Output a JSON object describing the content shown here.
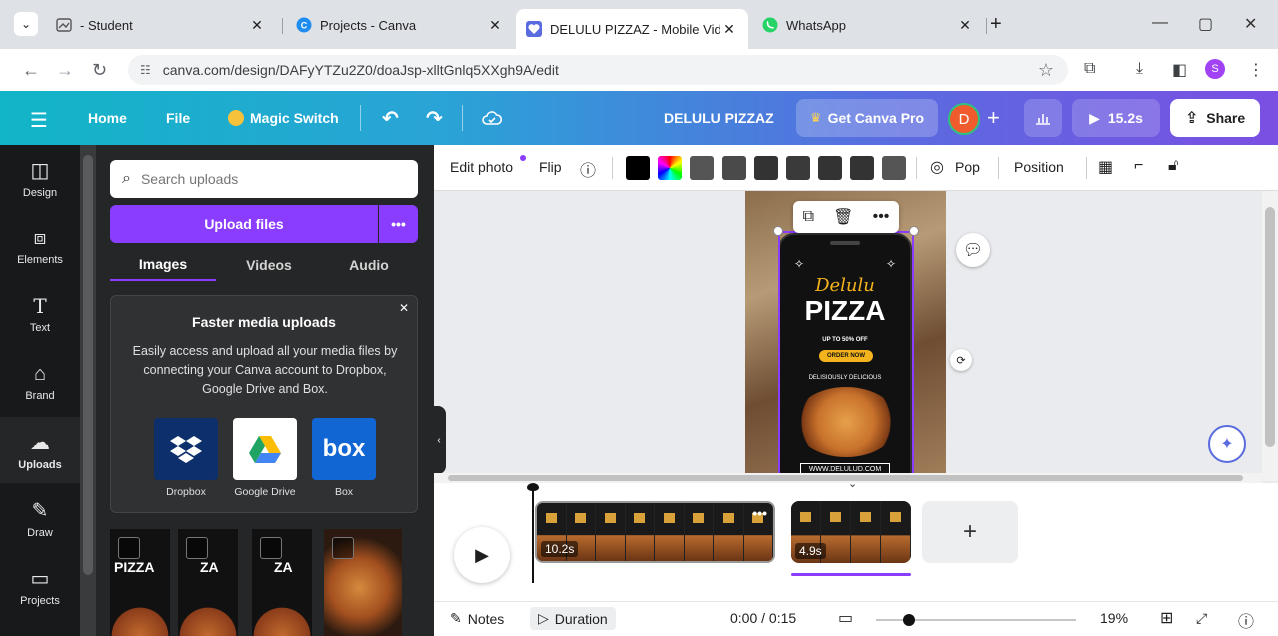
{
  "browser": {
    "tabs": [
      {
        "title": "- Student",
        "active": false
      },
      {
        "title": "Projects - Canva",
        "active": false
      },
      {
        "title": "DELULU PIZZAZ - Mobile Video",
        "active": true
      },
      {
        "title": "WhatsApp",
        "active": false
      }
    ],
    "url": "canva.com/design/DAFyYTZu2Z0/doaJsp-xlltGnlq5XXgh9A/edit",
    "profile_initial": "S"
  },
  "canva_bar": {
    "home": "Home",
    "file": "File",
    "magic_switch": "Magic Switch",
    "design_title": "DELULU PIZZAZ",
    "get_pro": "Get Canva Pro",
    "avatar_initial": "D",
    "duration": "15.2s",
    "share": "Share"
  },
  "rail": {
    "items": [
      {
        "label": "Design",
        "icon": "design-icon"
      },
      {
        "label": "Elements",
        "icon": "elements-icon"
      },
      {
        "label": "Text",
        "icon": "text-icon"
      },
      {
        "label": "Brand",
        "icon": "brand-icon"
      },
      {
        "label": "Uploads",
        "icon": "uploads-icon",
        "active": true
      },
      {
        "label": "Draw",
        "icon": "draw-icon"
      },
      {
        "label": "Projects",
        "icon": "projects-icon"
      }
    ]
  },
  "panel": {
    "search_placeholder": "Search uploads",
    "upload_label": "Upload files",
    "more_label": "•••",
    "tabs": [
      "Images",
      "Videos",
      "Audio"
    ],
    "card": {
      "title": "Faster media uploads",
      "body": "Easily access and upload all your media files by connecting your Canva account to Dropbox, Google Drive and Box.",
      "services": [
        "Dropbox",
        "Google Drive",
        "Box"
      ],
      "box_logo": "box"
    },
    "thumb_text": [
      "PIZZA",
      "ZA",
      "ZA"
    ]
  },
  "context_bar": {
    "edit_photo": "Edit photo",
    "flip": "Flip",
    "pop": "Pop",
    "position": "Position",
    "swatches": [
      "#000000",
      "rainbow",
      "#555555",
      "#4a4a4a",
      "#333333",
      "#3a3a3a",
      "#333333",
      "#333333",
      "#555555"
    ]
  },
  "design": {
    "script_title": "Delulu",
    "main_title": "PIZZA",
    "offer": "UP TO 50% OFF",
    "cta": "ORDER NOW",
    "tagline": "DELISIOUSLY DELICIOUS",
    "website": "WWW.DELULUD.COM"
  },
  "timeline": {
    "clips": [
      {
        "duration": "10.2s"
      },
      {
        "duration": "4.9s"
      }
    ],
    "add": "+"
  },
  "footer": {
    "notes": "Notes",
    "duration": "Duration",
    "time": "0:00 / 0:15",
    "zoom": "19%"
  }
}
